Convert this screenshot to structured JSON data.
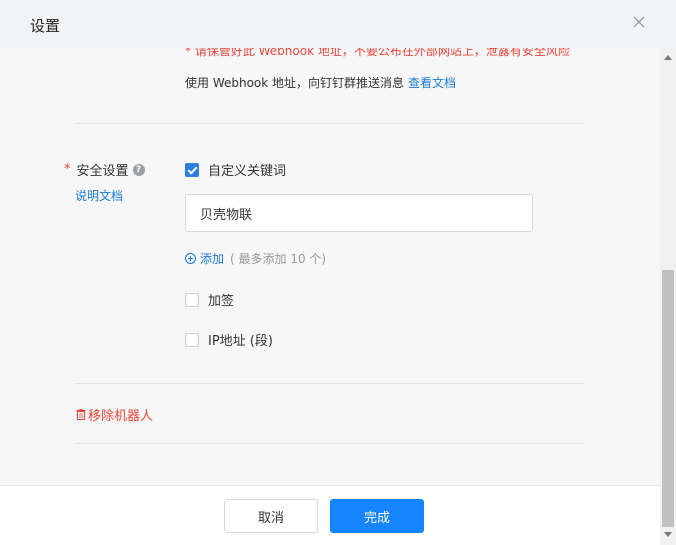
{
  "dialog": {
    "title": "设置"
  },
  "webhook": {
    "warning": "* 请保管好此 Webhook 地址，不要公布在外部网站上，泄露有安全风险",
    "info": "使用 Webhook 地址，向钉钉群推送消息",
    "doc_link": "查看文档"
  },
  "security": {
    "required_mark": "*",
    "label": "安全设置",
    "help_glyph": "?",
    "doc_link": "说明文档",
    "custom_keyword_label": "自定义关键词",
    "keyword_value": "贝壳物联",
    "add_label": "添加",
    "add_hint": "( 最多添加 10 个)",
    "sign_label": "加签",
    "ip_label": "IP地址 (段)"
  },
  "remove_robot": "移除机器人",
  "footer": {
    "cancel": "取消",
    "done": "完成"
  },
  "colors": {
    "primary": "#1684fc",
    "link": "#1a7ad6",
    "danger": "#e8463a"
  }
}
